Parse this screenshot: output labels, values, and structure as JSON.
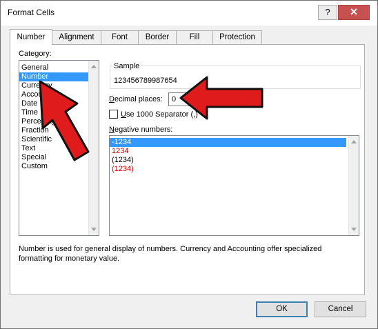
{
  "window": {
    "title": "Format Cells",
    "help_glyph": "?",
    "close_glyph": "✕"
  },
  "tabs": [
    {
      "label": "Number",
      "active": true
    },
    {
      "label": "Alignment",
      "active": false
    },
    {
      "label": "Font",
      "active": false
    },
    {
      "label": "Border",
      "active": false
    },
    {
      "label": "Fill",
      "active": false
    },
    {
      "label": "Protection",
      "active": false
    }
  ],
  "category": {
    "label_prefix": "C",
    "label_underlined": "ategory:",
    "items": [
      "General",
      "Number",
      "Currency",
      "Accounting",
      "Date",
      "Time",
      "Percentage",
      "Fraction",
      "Scientific",
      "Text",
      "Special",
      "Custom"
    ],
    "selected": "Number"
  },
  "sample": {
    "legend": "Sample",
    "value": "123456789987654"
  },
  "decimal_places": {
    "label_underlined": "D",
    "label_rest": "ecimal places:",
    "value": "0"
  },
  "separator": {
    "label_underlined": "U",
    "label_rest": "se 1000 Separator (,)",
    "checked": false
  },
  "negative_numbers": {
    "label_underlined": "N",
    "label_rest": "egative numbers:",
    "items": [
      {
        "text": "-1234",
        "color": "#ffffff",
        "selected": true
      },
      {
        "text": "1234",
        "color": "#d00000",
        "selected": false
      },
      {
        "text": "(1234)",
        "color": "#000000",
        "selected": false
      },
      {
        "text": "(1234)",
        "color": "#d00000",
        "selected": false
      }
    ]
  },
  "description": "Number is used for general display of numbers.  Currency and Accounting offer specialized formatting for monetary value.",
  "buttons": {
    "ok": "OK",
    "cancel": "Cancel"
  },
  "annotation_color": "#e01b1b"
}
